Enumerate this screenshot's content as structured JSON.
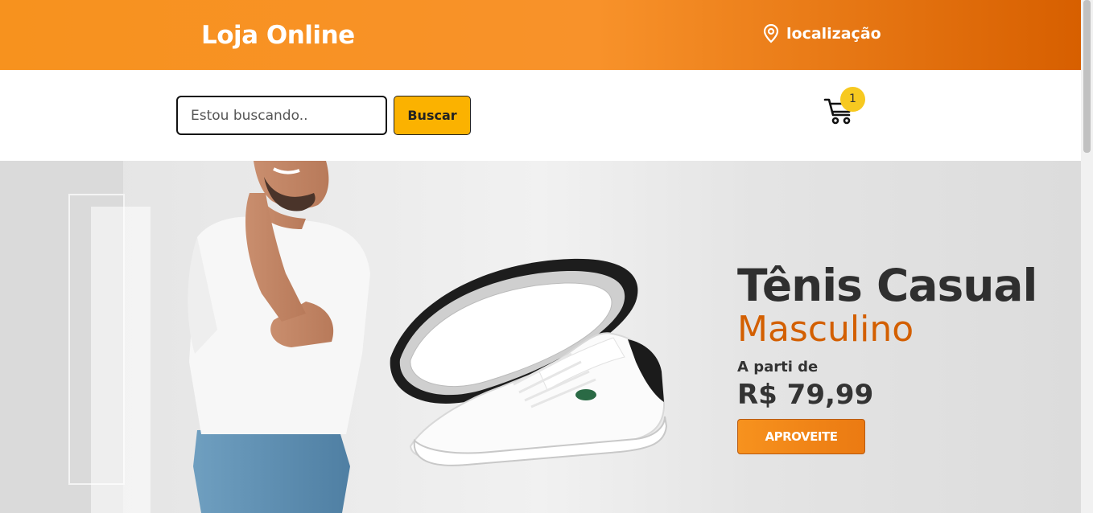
{
  "header": {
    "brand": "Loja Online",
    "location_label": "localização",
    "location_icon": "map-pin-icon",
    "colors": {
      "primary": "#f7921e",
      "dark": "#d75f00"
    }
  },
  "search": {
    "placeholder": "Estou buscando..",
    "button_label": "Buscar"
  },
  "cart": {
    "icon": "shopping-cart-icon",
    "count": "1"
  },
  "hero": {
    "title": "Tênis Casual",
    "subtitle": "Masculino",
    "from_label": "A parti de",
    "price": "R$ 79,99",
    "cta_label": "APROVEITE",
    "colors": {
      "title": "#2f2f2f",
      "subtitle": "#d35f00",
      "cta": "#f7921e"
    }
  }
}
